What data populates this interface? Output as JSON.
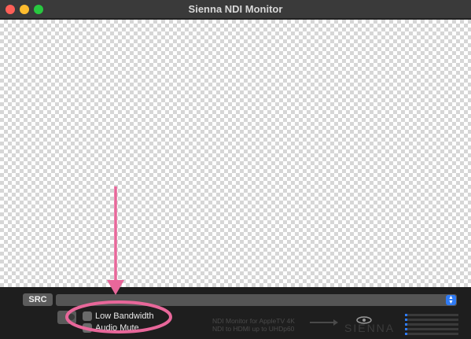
{
  "window": {
    "title": "Sienna NDI Monitor"
  },
  "controls": {
    "src_label": "SRC",
    "low_bandwidth_label": "Low Bandwidth",
    "audio_mute_label": "Audio Mute"
  },
  "promo": {
    "line1": "NDI Monitor for AppleTV 4K",
    "line2": "NDI to HDMI up to  UHDp60",
    "brand": "SIENNA"
  },
  "meters": {
    "levels": [
      0.02,
      0.02,
      0.02,
      0.02,
      0.02
    ]
  },
  "colors": {
    "annotation": "#e8679a",
    "accent": "#2f7bf5"
  }
}
